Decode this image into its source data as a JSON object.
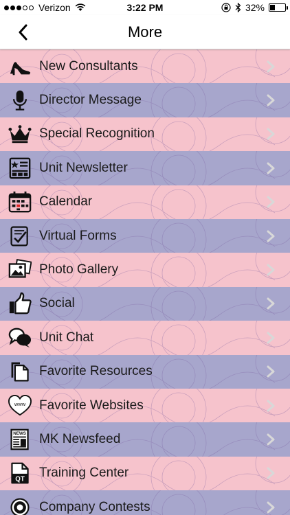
{
  "status_bar": {
    "carrier": "Verizon",
    "time": "3:22 PM",
    "battery": "32%",
    "battery_level": 0.32
  },
  "nav": {
    "title": "More"
  },
  "colors": {
    "pink": "#f6c3cc",
    "purple": "#a7a6cc",
    "chevron": "#d8d8d8"
  },
  "menu": {
    "items": [
      {
        "label": "New Consultants",
        "icon": "high-heel-icon"
      },
      {
        "label": "Director Message",
        "icon": "microphone-icon"
      },
      {
        "label": "Special Recognition",
        "icon": "crown-icon"
      },
      {
        "label": "Unit Newsletter",
        "icon": "newsletter-icon"
      },
      {
        "label": "Calendar",
        "icon": "calendar-icon"
      },
      {
        "label": "Virtual Forms",
        "icon": "form-check-icon"
      },
      {
        "label": "Photo Gallery",
        "icon": "photos-icon"
      },
      {
        "label": "Social",
        "icon": "thumbs-up-icon"
      },
      {
        "label": "Unit Chat",
        "icon": "chat-bubbles-icon"
      },
      {
        "label": "Favorite Resources",
        "icon": "documents-icon"
      },
      {
        "label": "Favorite Websites",
        "icon": "www-heart-icon"
      },
      {
        "label": "MK Newsfeed",
        "icon": "news-icon"
      },
      {
        "label": "Training Center",
        "icon": "qt-document-icon"
      },
      {
        "label": "Company Contests",
        "icon": "badge-icon"
      }
    ]
  }
}
